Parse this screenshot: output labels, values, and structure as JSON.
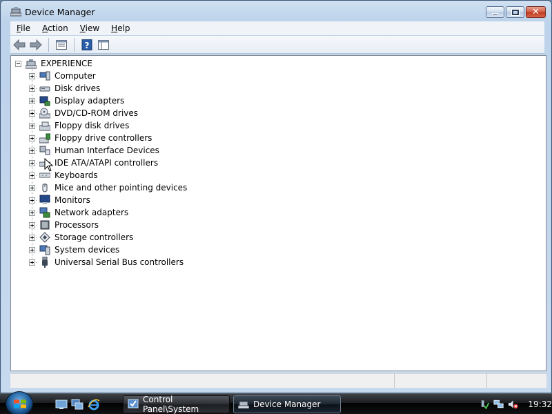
{
  "window": {
    "title": "Device Manager",
    "title_icon": "device-manager-icon"
  },
  "menu": [
    {
      "label": "File",
      "accel": "F",
      "rest": "ile"
    },
    {
      "label": "Action",
      "accel": "A",
      "rest": "ction"
    },
    {
      "label": "View",
      "accel": "V",
      "rest": "iew"
    },
    {
      "label": "Help",
      "accel": "H",
      "rest": "elp"
    }
  ],
  "toolbar": {
    "buttons": [
      "back-arrow-icon",
      "forward-arrow-icon",
      "properties-icon",
      "help-icon",
      "show-hide-console-tree-icon"
    ]
  },
  "tree": {
    "root": "EXPERIENCE",
    "items": [
      {
        "label": "Computer",
        "icon": "computer-icon"
      },
      {
        "label": "Disk drives",
        "icon": "disk-drive-icon"
      },
      {
        "label": "Display adapters",
        "icon": "display-adapter-icon"
      },
      {
        "label": "DVD/CD-ROM drives",
        "icon": "dvd-drive-icon"
      },
      {
        "label": "Floppy disk drives",
        "icon": "floppy-drive-icon"
      },
      {
        "label": "Floppy drive controllers",
        "icon": "floppy-controller-icon"
      },
      {
        "label": "Human Interface Devices",
        "icon": "hid-icon"
      },
      {
        "label": "IDE ATA/ATAPI controllers",
        "icon": "ide-controller-icon"
      },
      {
        "label": "Keyboards",
        "icon": "keyboard-icon"
      },
      {
        "label": "Mice and other pointing devices",
        "icon": "mouse-icon"
      },
      {
        "label": "Monitors",
        "icon": "monitor-icon"
      },
      {
        "label": "Network adapters",
        "icon": "network-adapter-icon"
      },
      {
        "label": "Processors",
        "icon": "processor-icon"
      },
      {
        "label": "Storage controllers",
        "icon": "storage-controller-icon"
      },
      {
        "label": "System devices",
        "icon": "system-devices-icon"
      },
      {
        "label": "Universal Serial Bus controllers",
        "icon": "usb-icon"
      }
    ]
  },
  "taskbar": {
    "buttons": [
      {
        "label": "Control Panel\\System",
        "icon": "control-panel-icon",
        "active": false
      },
      {
        "label": "Device Manager",
        "icon": "device-manager-icon",
        "active": true
      }
    ],
    "quick_launch": [
      "show-desktop-icon",
      "switch-windows-icon",
      "internet-explorer-icon"
    ],
    "tray_icons": [
      "safely-remove-icon",
      "network-icon",
      "volume-muted-icon"
    ],
    "clock": "19:32"
  },
  "colors": {
    "window_frame": "#c7d9ee",
    "taskbar": "#1a1c1f",
    "close_button": "#c0391f"
  }
}
